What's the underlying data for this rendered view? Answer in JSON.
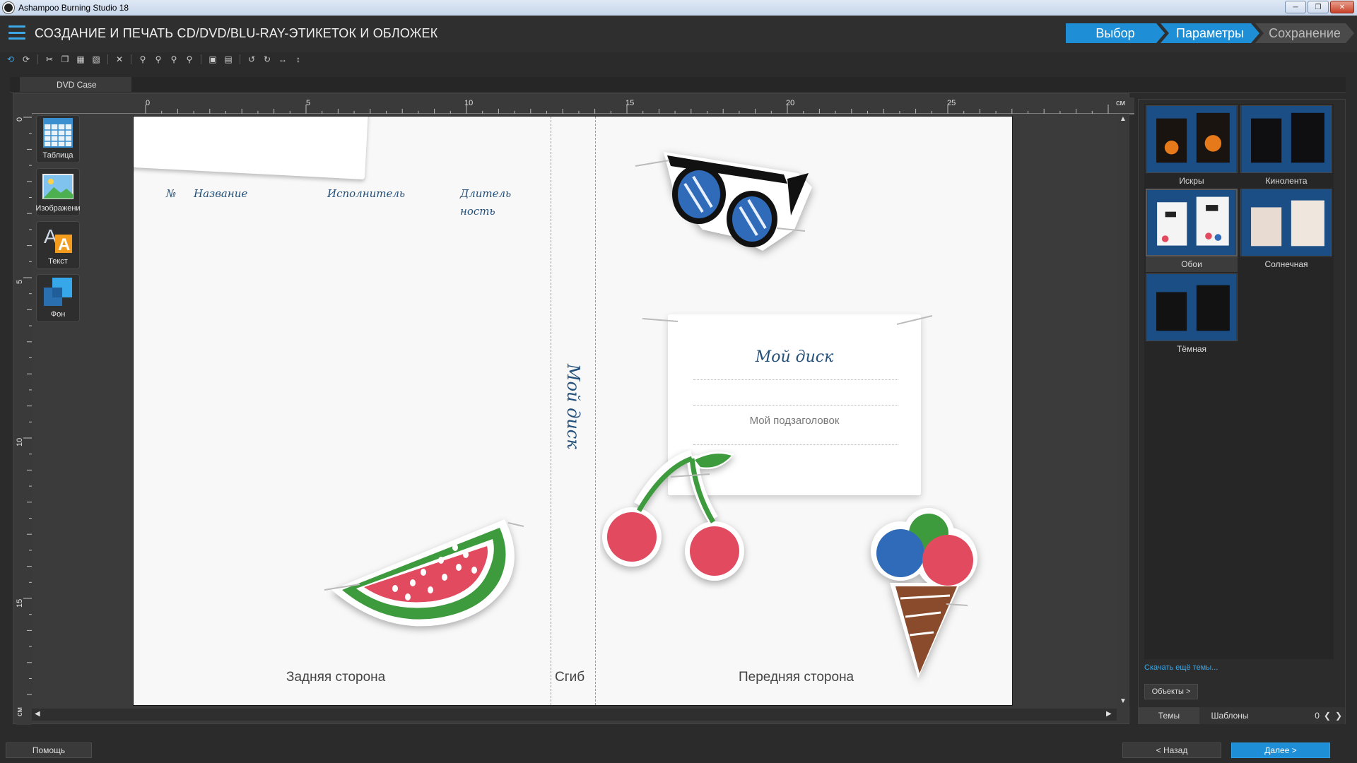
{
  "window": {
    "title": "Ashampoo Burning Studio 18"
  },
  "header": {
    "title": "СОЗДАНИЕ И ПЕЧАТЬ CD/DVD/BLU-RAY-ЭТИКЕТОК И ОБЛОЖЕК",
    "steps": [
      "Выбор",
      "Параметры",
      "Сохранение"
    ],
    "active_step_index": 1
  },
  "document": {
    "tab_label": "DVD Case"
  },
  "rulers": {
    "top_ticks": [
      "0",
      "5",
      "10",
      "15",
      "20",
      "25"
    ],
    "left_ticks": [
      "0",
      "5",
      "10",
      "15"
    ],
    "unit": "см"
  },
  "tools": [
    {
      "label": "Таблица",
      "icon": "table-icon"
    },
    {
      "label": "Изображени",
      "icon": "image-icon"
    },
    {
      "label": "Текст",
      "icon": "text-icon"
    },
    {
      "label": "Фон",
      "icon": "background-icon"
    }
  ],
  "page": {
    "columns": [
      "№",
      "Название",
      "Исполнитель",
      "Длитель ность"
    ],
    "spine_text": "Мой диск",
    "back_label": "Задняя сторона",
    "spine_label": "Сгиб",
    "front_label": "Передняя сторона",
    "card_title": "Мой диск",
    "card_subtitle": "Мой подзаголовок"
  },
  "themes": [
    {
      "label": "Искры"
    },
    {
      "label": "Кинолента"
    },
    {
      "label": "Обои",
      "selected": true
    },
    {
      "label": "Солнечная"
    },
    {
      "label": "Тёмная"
    }
  ],
  "right_panel": {
    "more_themes_link": "Скачать ещё темы...",
    "objects_button": "Объекты >",
    "tabs": [
      "Темы",
      "Шаблоны"
    ],
    "counter": "0"
  },
  "footer": {
    "help": "Помощь",
    "back": "< Назад",
    "next": "Далее >"
  },
  "colors": {
    "accent": "#1e8fd6",
    "ink": "#23507a"
  }
}
